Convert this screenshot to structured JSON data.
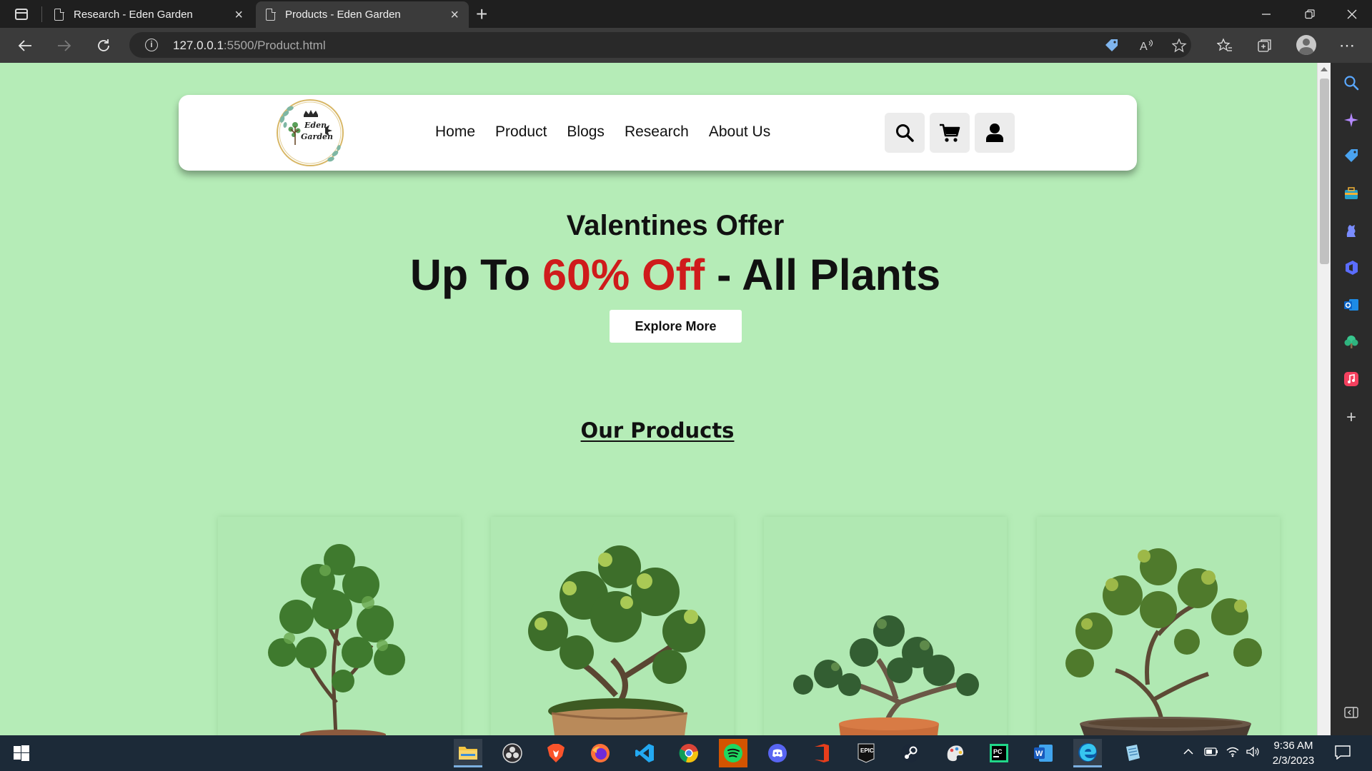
{
  "browser": {
    "tabs": [
      {
        "title": "Research - Eden Garden",
        "active": false
      },
      {
        "title": "Products - Eden Garden",
        "active": true
      }
    ],
    "url_host": "127.0.0.1",
    "url_rest": ":5500/Product.html"
  },
  "site": {
    "logo_text_line1": "Eden",
    "logo_text_line2": "Garden",
    "nav": [
      "Home",
      "Product",
      "Blogs",
      "Research",
      "About Us"
    ],
    "hero_subtitle": "Valentines Offer",
    "hero_title_prefix": "Up To ",
    "hero_title_highlight": "60% Off",
    "hero_title_suffix": " - All Plants",
    "explore_label": "Explore More",
    "section_title": "Our Products",
    "colors": {
      "page_bg": "#b5ecb7",
      "highlight": "#cf1b1b",
      "header_bg": "#ffffff"
    },
    "products": [
      {
        "image": "ficus-bonsai-tree"
      },
      {
        "image": "leafy-bonsai-wooden-pot"
      },
      {
        "image": "bonsai-terracotta-pot"
      },
      {
        "image": "bonsai-dark-pot"
      }
    ]
  },
  "taskbar": {
    "time": "9:36 AM",
    "date": "2/3/2023",
    "apps": [
      "file-explorer",
      "obs",
      "brave",
      "firefox",
      "vscode",
      "chrome",
      "spotify",
      "discord",
      "office",
      "epic-games",
      "steam",
      "paint",
      "pycharm",
      "word",
      "edge",
      "notepad"
    ]
  }
}
